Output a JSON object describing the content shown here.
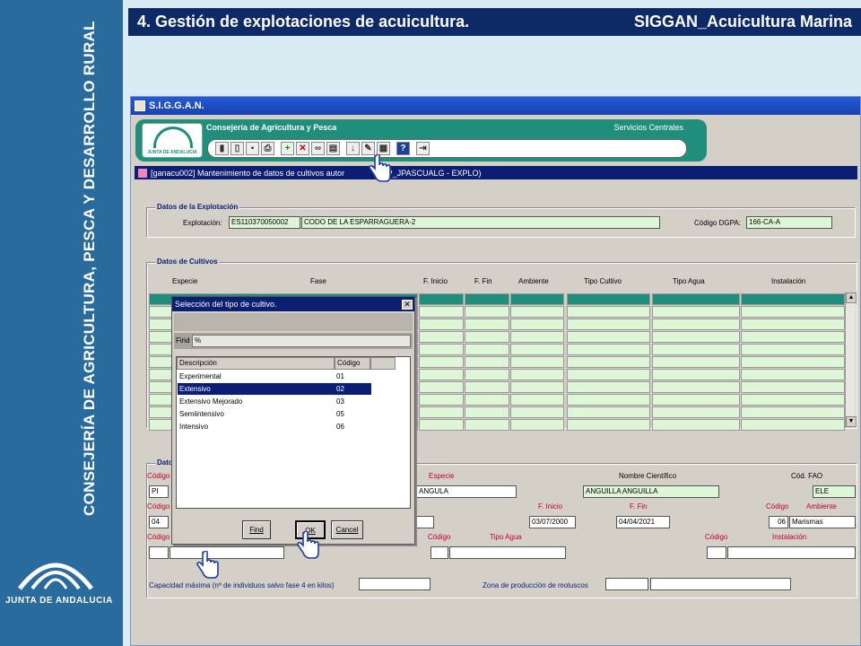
{
  "slide": {
    "title": "4. Gestión de explotaciones de acuicultura.",
    "right_title": "SIGGAN_Acuicultura Marina",
    "side_text": "CONSEJERÍA DE AGRICULTURA, PESCA Y DESARROLLO RURAL",
    "side_logo_text": "JUNTA DE ANDALUCIA"
  },
  "window": {
    "title": "S.I.G.G.A.N.",
    "header_org": "Consejería de Agricultura y Pesca",
    "header_services": "Servicios Centrales",
    "logo_text": "JUNTA DE ANDALUCIA",
    "form_title": "[ganacu002] Mantenimiento de datos de cultivos autor",
    "form_user": "(DAP_JPASCUALG - EXPLO)"
  },
  "toolbar": {
    "buttons": [
      "save-icon",
      "print-icon",
      "add-icon",
      "delete-icon",
      "binoculars-icon",
      "query-icon",
      "download-icon",
      "edit-icon",
      "report-icon",
      "help-icon",
      "exit-icon"
    ]
  },
  "explotacion": {
    "group_label": "Datos de la Explotación",
    "label": "Explotación:",
    "code": "ES110370050002",
    "name": "CODO DE LA ESPARRAGUERA-2",
    "dgpa_label": "Código DGPA:",
    "dgpa": "166-CA-A"
  },
  "cultivos": {
    "group_label": "Datos de Cultivos",
    "columns": [
      "Especie",
      "Fase",
      "F. Inicio",
      "F. Fin",
      "Ambiente",
      "Tipo Cultivo",
      "Tipo Agua",
      "Instalación"
    ]
  },
  "detalle": {
    "group_label": "Dato",
    "codigo": "Código",
    "codigo_value": "PI",
    "especie_label": "Especie",
    "especie_value": "ANGULA",
    "nombre_cientifico_label": "Nombre Científico",
    "nombre_cientifico_value": "ANGUILLA ANGUILLA",
    "cod_fao_label": "Cód. FAO",
    "cod_fao_value": "ELE",
    "codigo2_value": "04",
    "f_inicio_label": "F. Inicio",
    "f_inicio_value": "03/07/2000",
    "f_fin_label": "F. Fin",
    "f_fin_value": "04/04/2021",
    "ambiente_label": "Ambiente",
    "ambiente_code": "06",
    "ambiente_value": "Marismas",
    "tipo_agua_label": "Tipo Agua",
    "instalacion_label": "Instalación",
    "capacidad_label": "Capacidad máxima (nº de individuos salvo fase 4 en kilos)",
    "zona_label": "Zona de producción de moluscos"
  },
  "dialog": {
    "title": "Selección del tipo de cultivo.",
    "close": "✕",
    "find_label": "Find",
    "find_value": "%",
    "col_descripcion": "Descripción",
    "col_codigo": "Código",
    "rows": [
      {
        "descripcion": "Experimental",
        "codigo": "01"
      },
      {
        "descripcion": "Extensivo",
        "codigo": "02"
      },
      {
        "descripcion": "Extensivo Mejorado",
        "codigo": "03"
      },
      {
        "descripcion": "Semiintensivo",
        "codigo": "05"
      },
      {
        "descripcion": "Intensivo",
        "codigo": "06"
      }
    ],
    "selected_index": 1,
    "btn_find": "Find",
    "btn_ok": "OK",
    "btn_cancel": "Cancel"
  }
}
